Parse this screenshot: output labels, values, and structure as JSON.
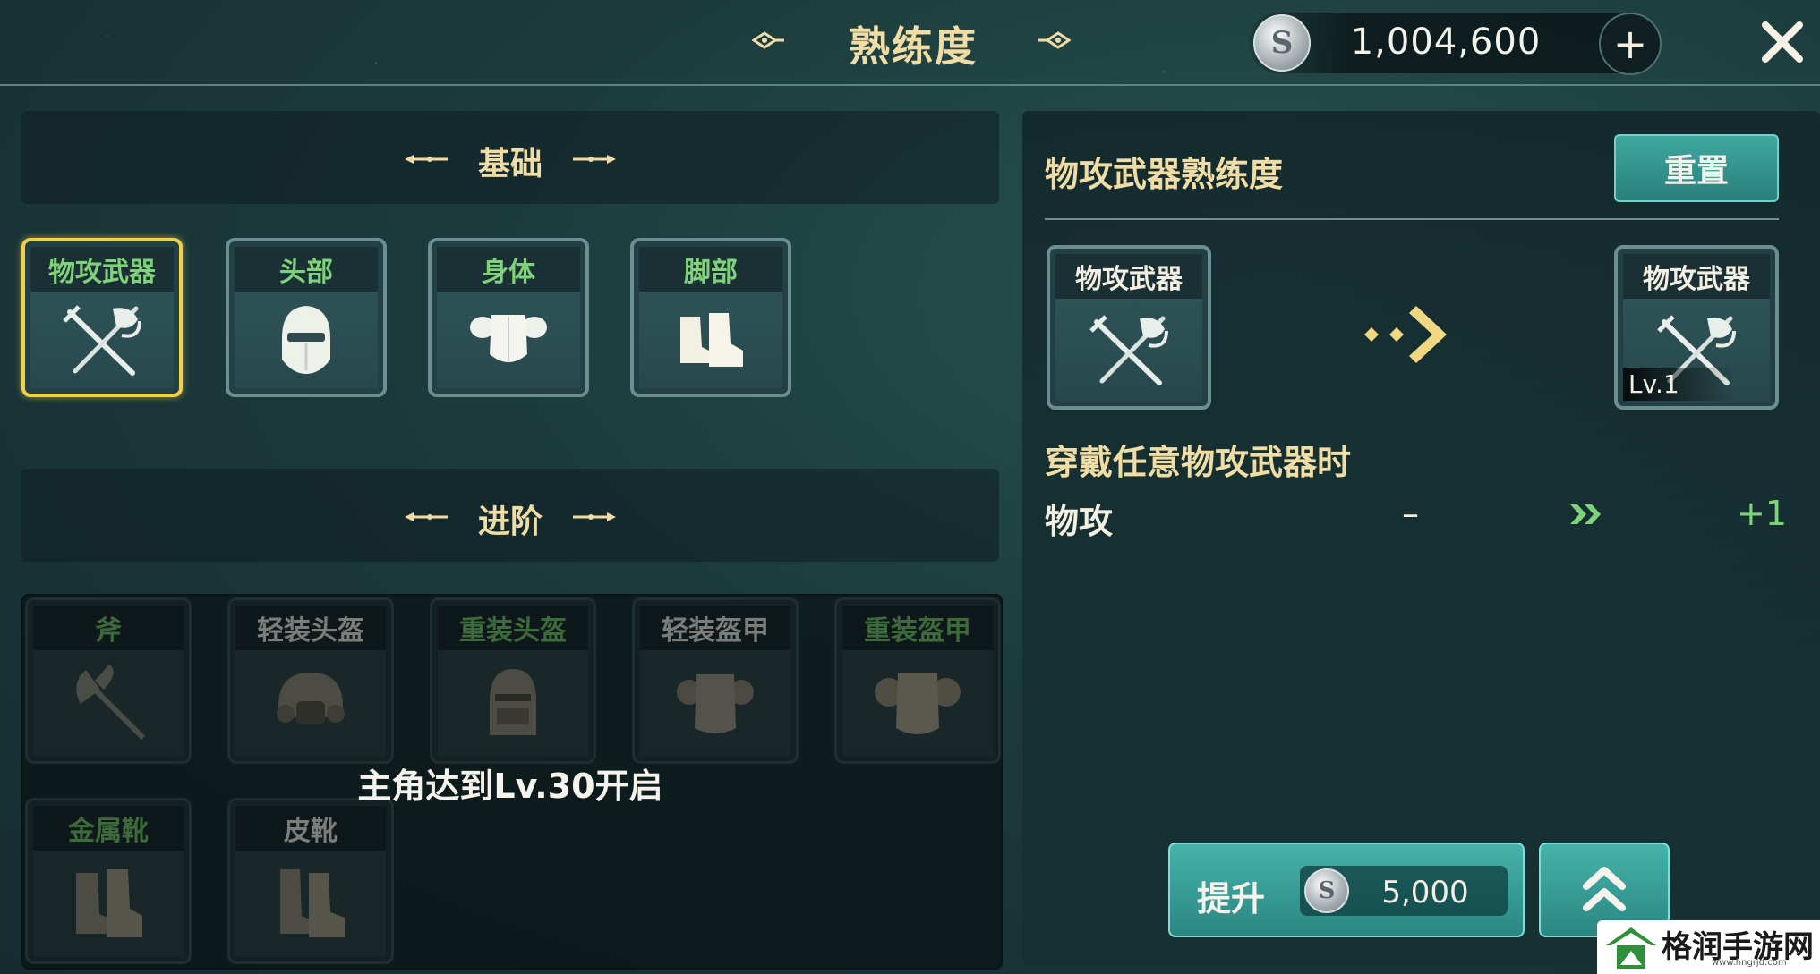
{
  "header": {
    "title": "熟练度",
    "currency_value": "1,004,600",
    "currency_icon": "silver-coin-icon",
    "coin_letter": "S",
    "plus_label": "+",
    "close_icon": "close-icon"
  },
  "basic_section": {
    "title": "基础",
    "items": [
      {
        "label": "物攻武器",
        "icon": "sword-axe-icon",
        "label_color": "#7fd27a",
        "selected": true
      },
      {
        "label": "头部",
        "icon": "helmet-icon",
        "label_color": "#7fd27a",
        "selected": false
      },
      {
        "label": "身体",
        "icon": "armor-icon",
        "label_color": "#7fd27a",
        "selected": false
      },
      {
        "label": "脚部",
        "icon": "boots-icon",
        "label_color": "#7fd27a",
        "selected": false
      }
    ]
  },
  "advanced_section": {
    "title": "进阶",
    "items": [
      {
        "label": "斧",
        "icon": "axe-icon"
      },
      {
        "label": "轻装头盔",
        "icon": "light-helmet-icon"
      },
      {
        "label": "重装头盔",
        "icon": "heavy-helmet-icon"
      },
      {
        "label": "轻装盔甲",
        "icon": "light-armor-icon"
      },
      {
        "label": "重装盔甲",
        "icon": "heavy-armor-icon"
      },
      {
        "label": "金属靴",
        "icon": "metal-boots-icon"
      },
      {
        "label": "皮靴",
        "icon": "leather-boots-icon"
      }
    ],
    "locked_text": "主角达到Lv.30开启"
  },
  "detail": {
    "title": "物攻武器熟练度",
    "reset_label": "重置",
    "current_card_label": "物攻武器",
    "next_card_label": "物攻武器",
    "next_level": "Lv.1",
    "condition": "穿戴任意物攻武器时",
    "stat_name": "物攻",
    "stat_old": "–",
    "stat_new": "+1",
    "upgrade_label": "提升",
    "upgrade_cost": "5,000"
  },
  "colors": {
    "gold_text": "#f0dca5",
    "green_text": "#7fd27a",
    "selected_border": "#f0d24a",
    "button_teal": "#46b3aa"
  },
  "watermark": {
    "text": "格润手游网",
    "sub": "www.hngrjd.com"
  }
}
